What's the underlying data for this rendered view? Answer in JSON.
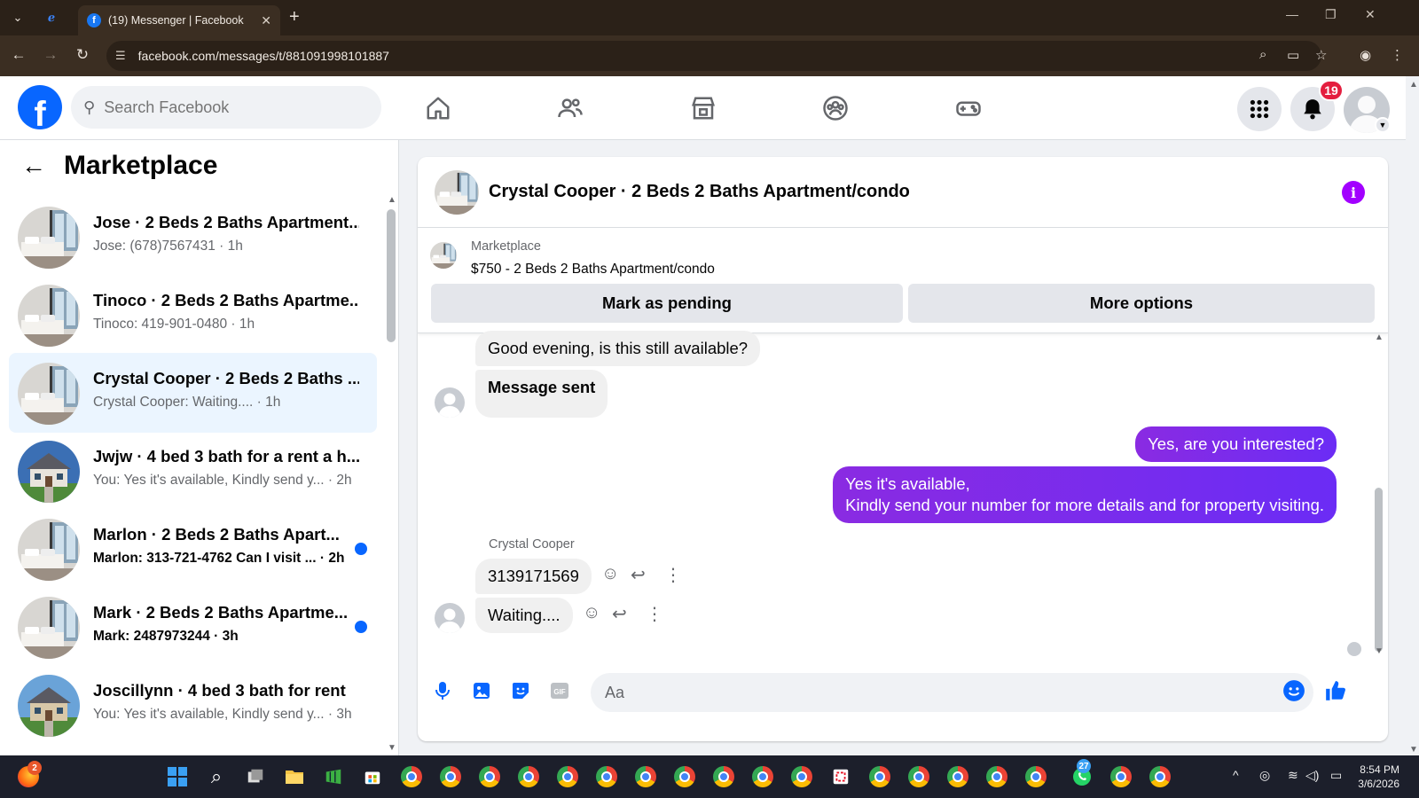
{
  "browser": {
    "tab_title": "(19) Messenger | Facebook",
    "url": "facebook.com/messages/t/881091998101887"
  },
  "header": {
    "search_placeholder": "Search Facebook",
    "notification_count": "19",
    "brand_color": "#0866ff"
  },
  "sidebar": {
    "title": "Marketplace",
    "conversations": [
      {
        "name": "Jose · 2 Beds 2 Baths Apartment...",
        "preview": "Jose: (678)7567431 · 1h",
        "unread": false,
        "active": false,
        "image": "bedroom"
      },
      {
        "name": "Tinoco · 2 Beds 2 Baths Apartme...",
        "preview": "Tinoco: 419-901-0480 · 1h",
        "unread": false,
        "active": false,
        "image": "bedroom"
      },
      {
        "name": "Crystal Cooper · 2 Beds 2 Baths ...",
        "preview": "Crystal Cooper: Waiting.... · 1h",
        "unread": false,
        "active": true,
        "image": "bedroom"
      },
      {
        "name": "Jwjw · 4 bed 3 bath for a rent a h...",
        "preview": "You: Yes it's available, Kindly send y... · 2h",
        "unread": false,
        "active": false,
        "image": "house"
      },
      {
        "name": "Marlon · 2 Beds 2 Baths Apart...",
        "preview": "Marlon: 313-721-4762 Can I visit ... · 2h",
        "unread": true,
        "active": false,
        "image": "bedroom"
      },
      {
        "name": "Mark · 2 Beds 2 Baths Apartme...",
        "preview": "Mark: 2487973244 · 3h",
        "unread": true,
        "active": false,
        "image": "bedroom"
      },
      {
        "name": "Joscillynn · 4 bed 3 bath for rent",
        "preview": "You: Yes it's available, Kindly send y... · 3h",
        "unread": false,
        "active": false,
        "image": "house2"
      }
    ]
  },
  "chat": {
    "title": "Crystal Cooper · 2 Beds 2 Baths Apartment/condo",
    "listing_category": "Marketplace",
    "listing_price": "$750 - 2 Beds 2 Baths Apartment/condo",
    "mark_pending_label": "Mark as pending",
    "more_options_label": "More options",
    "messages": {
      "in_1": "Good evening, is this still available?",
      "in_2": "Message sent",
      "out_1": "Yes, are you interested?",
      "out_2_line1": "Yes it's available,",
      "out_2_line2": "Kindly send your number for more details and for property visiting.",
      "sender_name": "Crystal Cooper",
      "in_3": "3139171569",
      "in_4": "Waiting...."
    },
    "composer_placeholder": "Aa",
    "accent_color": "#7b2ff7"
  },
  "taskbar": {
    "time": "8:54 PM",
    "date": "3/6/2026",
    "firefox_badge": "2",
    "whatsapp_badge": "27"
  }
}
